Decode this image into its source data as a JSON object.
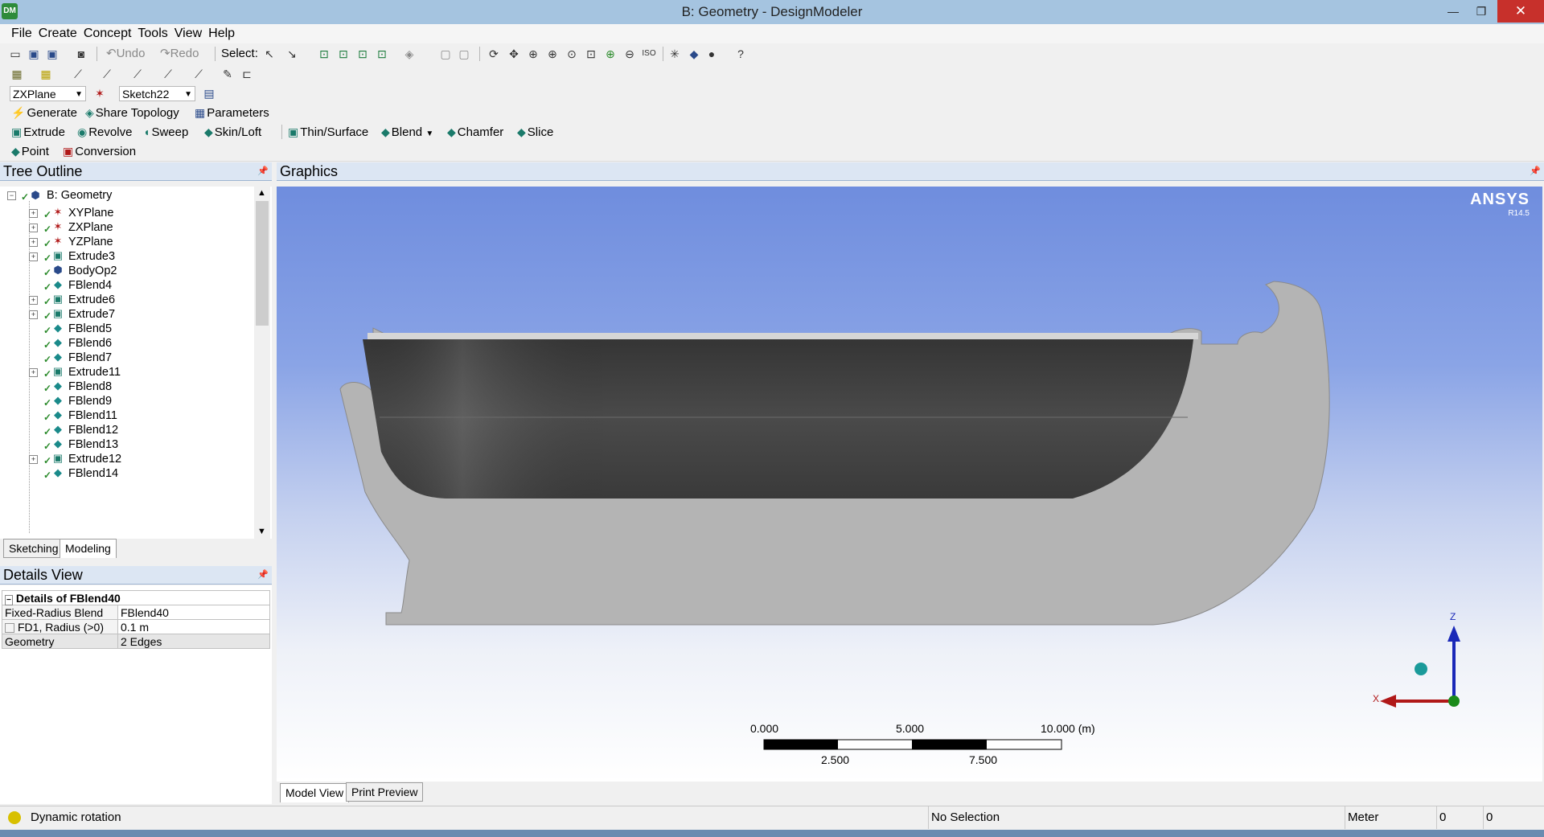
{
  "window": {
    "title": "B: Geometry - DesignModeler",
    "app_icon_text": "DM",
    "minimize": "—",
    "maximize": "❐",
    "close": "✕"
  },
  "menu": [
    "File",
    "Create",
    "Concept",
    "Tools",
    "View",
    "Help"
  ],
  "toolbar1": {
    "undo_label": "Undo",
    "redo_label": "Redo",
    "select_label": "Select:"
  },
  "toolbar3": {
    "plane_combo": "ZXPlane",
    "sketch_combo": "Sketch22"
  },
  "toolbar4": {
    "generate": "Generate",
    "share_topology": "Share Topology",
    "parameters": "Parameters"
  },
  "toolbar5": {
    "extrude": "Extrude",
    "revolve": "Revolve",
    "sweep": "Sweep",
    "skin_loft": "Skin/Loft",
    "thin_surface": "Thin/Surface",
    "blend": "Blend",
    "chamfer": "Chamfer",
    "slice": "Slice"
  },
  "toolbar6": {
    "point": "Point",
    "conversion": "Conversion"
  },
  "tree_outline": {
    "title": "Tree Outline",
    "root": "B: Geometry",
    "items": [
      {
        "label": "XYPlane",
        "expandable": true,
        "icon": "plane-icon"
      },
      {
        "label": "ZXPlane",
        "expandable": true,
        "icon": "plane-icon"
      },
      {
        "label": "YZPlane",
        "expandable": true,
        "icon": "plane-icon"
      },
      {
        "label": "Extrude3",
        "expandable": true,
        "icon": "extrude-icon"
      },
      {
        "label": "BodyOp2",
        "expandable": false,
        "icon": "bodyop-icon"
      },
      {
        "label": "FBlend4",
        "expandable": false,
        "icon": "blend-icon"
      },
      {
        "label": "Extrude6",
        "expandable": true,
        "icon": "extrude-icon"
      },
      {
        "label": "Extrude7",
        "expandable": true,
        "icon": "extrude-icon"
      },
      {
        "label": "FBlend5",
        "expandable": false,
        "icon": "blend-icon"
      },
      {
        "label": "FBlend6",
        "expandable": false,
        "icon": "blend-icon"
      },
      {
        "label": "FBlend7",
        "expandable": false,
        "icon": "blend-icon"
      },
      {
        "label": "Extrude11",
        "expandable": true,
        "icon": "extrude-icon"
      },
      {
        "label": "FBlend8",
        "expandable": false,
        "icon": "blend-icon"
      },
      {
        "label": "FBlend9",
        "expandable": false,
        "icon": "blend-icon"
      },
      {
        "label": "FBlend11",
        "expandable": false,
        "icon": "blend-icon"
      },
      {
        "label": "FBlend12",
        "expandable": false,
        "icon": "blend-icon"
      },
      {
        "label": "FBlend13",
        "expandable": false,
        "icon": "blend-icon"
      },
      {
        "label": "Extrude12",
        "expandable": true,
        "icon": "extrude-icon"
      },
      {
        "label": "FBlend14",
        "expandable": false,
        "icon": "blend-icon"
      }
    ],
    "tabs": [
      "Sketching",
      "Modeling"
    ],
    "active_tab": "Modeling"
  },
  "details_view": {
    "title": "Details View",
    "header": "Details of FBlend40",
    "rows": [
      {
        "key": "Fixed-Radius Blend",
        "value": "FBlend40"
      },
      {
        "key": "FD1, Radius (>0)",
        "value": "0.1 m"
      },
      {
        "key": "Geometry",
        "value": "2 Edges"
      }
    ]
  },
  "graphics": {
    "title": "Graphics",
    "logo": "ANSYS",
    "version": "R14.5",
    "scale": {
      "top_labels": [
        "0.000",
        "5.000",
        "10.000 (m)"
      ],
      "bottom_labels": [
        "2.500",
        "7.500"
      ]
    },
    "triad": {
      "z": "Z",
      "x": "X"
    },
    "tabs": [
      "Model View",
      "Print Preview"
    ],
    "active_tab": "Model View"
  },
  "status": {
    "message": "Dynamic rotation",
    "selection": "No Selection",
    "units": "Meter",
    "v1": "0",
    "v2": "0"
  },
  "colors": {
    "title_bar": "#a5c4e0",
    "close_button": "#c7302b",
    "panel_header": "#dce6f3",
    "viewport_top": "#6f8dde",
    "hull_dark": "#3a3a3a",
    "hull_light": "#b4b4b4"
  }
}
